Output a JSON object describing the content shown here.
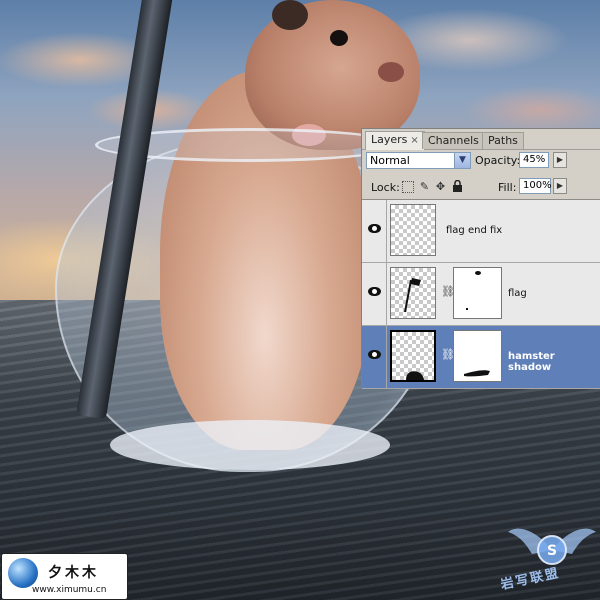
{
  "panel": {
    "tabs": [
      {
        "label": "Layers",
        "active": true,
        "closable": true
      },
      {
        "label": "Channels",
        "active": false
      },
      {
        "label": "Paths",
        "active": false
      }
    ],
    "close_glyph": "×",
    "blend_mode": "Normal",
    "opacity_label": "Opacity:",
    "opacity_value": "45%",
    "lock_label": "Lock:",
    "fill_label": "Fill:",
    "fill_value": "100%",
    "layers": [
      {
        "name": "flag end fix",
        "visible": true,
        "has_mask": false,
        "selected": false
      },
      {
        "name": "flag",
        "visible": true,
        "has_mask": true,
        "selected": false
      },
      {
        "name": "hamster shadow",
        "visible": true,
        "has_mask": true,
        "selected": true
      }
    ],
    "icons": {
      "dropdown": "chevron-down-icon",
      "flyout": "arrow-right-icon",
      "lock_transparent": "checkerboard-icon",
      "lock_paint": "brush-icon",
      "lock_move": "move-icon",
      "lock_all": "lock-icon",
      "eye": "eye-icon",
      "link": "chain-link-icon"
    },
    "colors": {
      "panel_bg": "#d4d0c8",
      "selected_row": "#5f7fb8",
      "row_bg": "#e9e9e9"
    }
  },
  "watermarks": {
    "logo_text": "夕木木",
    "logo_url": "www.ximumu.cn",
    "badge_text": "岩写联盟"
  }
}
